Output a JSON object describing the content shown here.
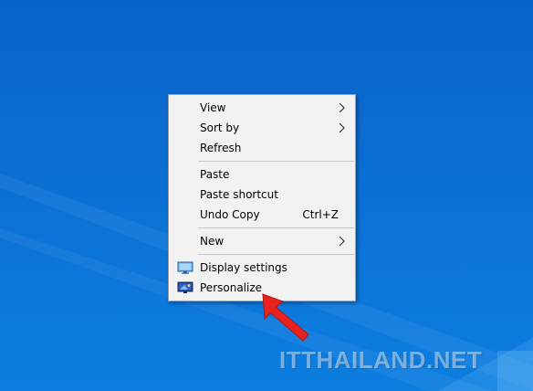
{
  "menu": {
    "groups": [
      [
        {
          "label": "View",
          "submenu": true
        },
        {
          "label": "Sort by",
          "submenu": true
        },
        {
          "label": "Refresh"
        }
      ],
      [
        {
          "label": "Paste"
        },
        {
          "label": "Paste shortcut"
        },
        {
          "label": "Undo Copy",
          "shortcut": "Ctrl+Z"
        }
      ],
      [
        {
          "label": "New",
          "submenu": true
        }
      ],
      [
        {
          "label": "Display settings",
          "icon": "display-settings-icon"
        },
        {
          "label": "Personalize",
          "icon": "personalize-icon"
        }
      ]
    ]
  },
  "watermark": {
    "text": "ITTHAILAND.NET"
  },
  "colors": {
    "desktop_bg": "#0b6fd4",
    "menu_bg": "#f2f2f2",
    "arrow": "#e8231f"
  }
}
